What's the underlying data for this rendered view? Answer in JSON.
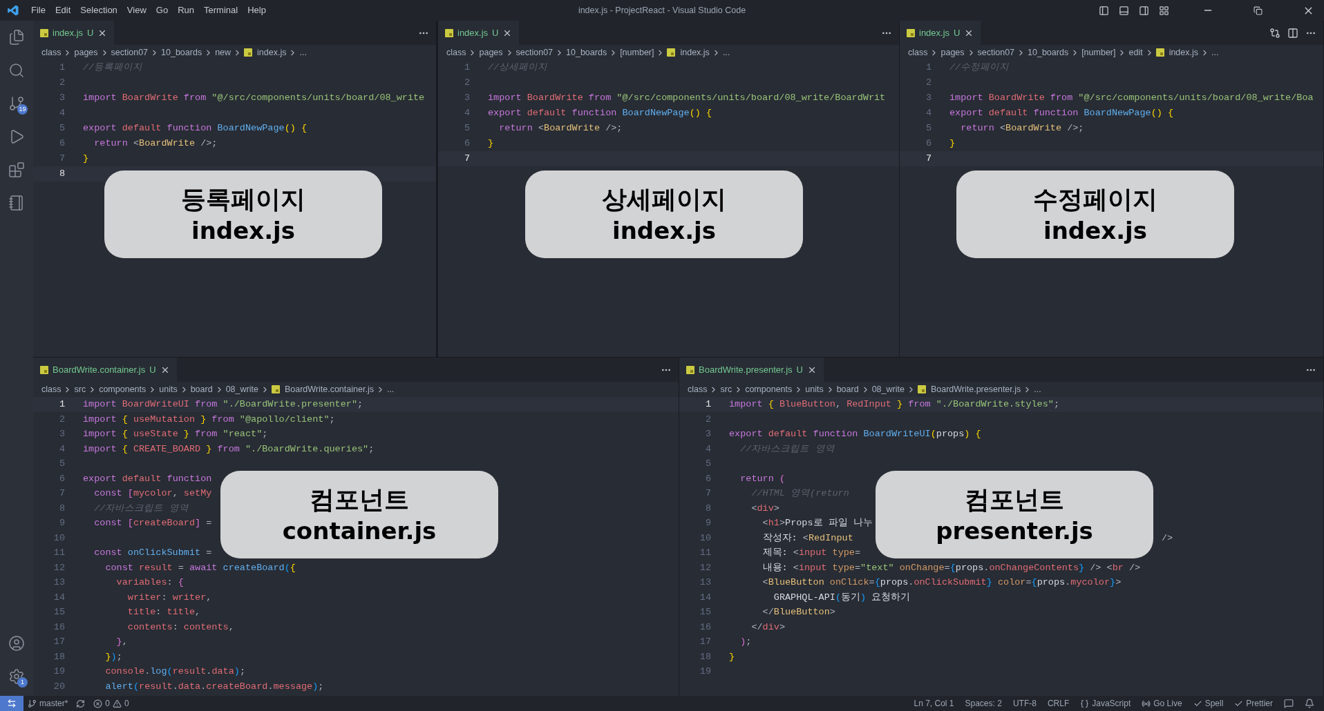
{
  "window": {
    "title": "index.js - ProjectReact - Visual Studio Code"
  },
  "menu": [
    "File",
    "Edit",
    "Selection",
    "View",
    "Go",
    "Run",
    "Terminal",
    "Help"
  ],
  "activity_bar": {
    "top": [
      {
        "kind": "explorer"
      },
      {
        "kind": "search"
      },
      {
        "kind": "source-control",
        "badge": "19"
      },
      {
        "kind": "run"
      },
      {
        "kind": "extensions"
      },
      {
        "kind": "notebook"
      }
    ],
    "bottom": [
      {
        "kind": "account"
      },
      {
        "kind": "settings",
        "badge": "1"
      }
    ]
  },
  "panes": [
    {
      "tab": {
        "label": "index.js",
        "status": "U",
        "selected": true
      },
      "actions": [
        {
          "kind": "more"
        }
      ],
      "breadcrumb": [
        {
          "label": "class",
          "kind": "folder"
        },
        {
          "label": "pages",
          "kind": "folder"
        },
        {
          "label": "section07",
          "kind": "folder"
        },
        {
          "label": "10_boards",
          "kind": "folder"
        },
        {
          "label": "new",
          "kind": "folder"
        },
        {
          "label": "index.js",
          "kind": "file"
        },
        {
          "label": "...",
          "kind": "folder"
        }
      ],
      "lines": [
        {
          "n": "1",
          "active": false,
          "tokens": [
            {
              "kind": "cm",
              "text": "//등록페이지"
            }
          ]
        },
        {
          "n": "2",
          "active": false
        },
        {
          "n": "3",
          "active": false,
          "tokens": [
            {
              "kind": "kw",
              "text": "import "
            },
            {
              "kind": "red",
              "text": "BoardWrite "
            },
            {
              "kind": "kw",
              "text": "from "
            },
            {
              "kind": "str",
              "text": "\"@/src/components/units/board/08_write"
            }
          ]
        },
        {
          "n": "4",
          "active": false
        },
        {
          "n": "5",
          "active": false,
          "tokens": [
            {
              "kind": "kw",
              "text": "export "
            },
            {
              "kind": "red",
              "text": "default "
            },
            {
              "kind": "kw",
              "text": "function "
            },
            {
              "kind": "fn",
              "text": "BoardNewPage"
            },
            {
              "kind": "y",
              "text": "() {"
            }
          ]
        },
        {
          "n": "6",
          "active": false,
          "tokens": [
            {
              "kind": "kw",
              "text": "  return "
            },
            {
              "kind": "pl",
              "text": "<"
            },
            {
              "kind": "tag",
              "text": "BoardWrite"
            },
            {
              "kind": "pl",
              "text": " />;"
            }
          ]
        },
        {
          "n": "7",
          "active": false,
          "tokens": [
            {
              "kind": "y",
              "text": "}"
            }
          ]
        },
        {
          "n": "8",
          "active": true
        }
      ],
      "caption": {
        "title": "등록페이지",
        "file": "index.js"
      }
    },
    {
      "tab": {
        "label": "index.js",
        "status": "U",
        "selected": true
      },
      "actions": [
        {
          "kind": "more"
        }
      ],
      "breadcrumb": [
        {
          "label": "class",
          "kind": "folder"
        },
        {
          "label": "pages",
          "kind": "folder"
        },
        {
          "label": "section07",
          "kind": "folder"
        },
        {
          "label": "10_boards",
          "kind": "folder"
        },
        {
          "label": "[number]",
          "kind": "folder"
        },
        {
          "label": "index.js",
          "kind": "file"
        },
        {
          "label": "...",
          "kind": "folder"
        }
      ],
      "lines": [
        {
          "n": "1",
          "active": false,
          "tokens": [
            {
              "kind": "cm",
              "text": "//상세페이지"
            }
          ]
        },
        {
          "n": "2",
          "active": false
        },
        {
          "n": "3",
          "active": false,
          "tokens": [
            {
              "kind": "kw",
              "text": "import "
            },
            {
              "kind": "red",
              "text": "BoardWrite "
            },
            {
              "kind": "kw",
              "text": "from "
            },
            {
              "kind": "str",
              "text": "\"@/src/components/units/board/08_write/BoardWrit"
            }
          ]
        },
        {
          "n": "4",
          "active": false,
          "tokens": [
            {
              "kind": "kw",
              "text": "export "
            },
            {
              "kind": "red",
              "text": "default "
            },
            {
              "kind": "kw",
              "text": "function "
            },
            {
              "kind": "fn",
              "text": "BoardNewPage"
            },
            {
              "kind": "y",
              "text": "() {"
            }
          ]
        },
        {
          "n": "5",
          "active": false,
          "tokens": [
            {
              "kind": "kw",
              "text": "  return "
            },
            {
              "kind": "pl",
              "text": "<"
            },
            {
              "kind": "tag",
              "text": "BoardWrite"
            },
            {
              "kind": "pl",
              "text": " />;"
            }
          ]
        },
        {
          "n": "6",
          "active": false,
          "tokens": [
            {
              "kind": "y",
              "text": "}"
            }
          ]
        },
        {
          "n": "7",
          "active": true
        }
      ],
      "caption": {
        "title": "상세페이지",
        "file": "index.js"
      }
    },
    {
      "tab": {
        "label": "index.js",
        "status": "U",
        "selected": true
      },
      "actions": [
        {
          "kind": "compare"
        },
        {
          "kind": "split"
        },
        {
          "kind": "more"
        }
      ],
      "breadcrumb": [
        {
          "label": "class",
          "kind": "folder"
        },
        {
          "label": "pages",
          "kind": "folder"
        },
        {
          "label": "section07",
          "kind": "folder"
        },
        {
          "label": "10_boards",
          "kind": "folder"
        },
        {
          "label": "[number]",
          "kind": "folder"
        },
        {
          "label": "edit",
          "kind": "folder"
        },
        {
          "label": "index.js",
          "kind": "file"
        },
        {
          "label": "...",
          "kind": "folder"
        }
      ],
      "lines": [
        {
          "n": "1",
          "active": false,
          "tokens": [
            {
              "kind": "cm",
              "text": "//수정페이지"
            }
          ]
        },
        {
          "n": "2",
          "active": false
        },
        {
          "n": "3",
          "active": false,
          "tokens": [
            {
              "kind": "kw",
              "text": "import "
            },
            {
              "kind": "red",
              "text": "BoardWrite "
            },
            {
              "kind": "kw",
              "text": "from "
            },
            {
              "kind": "str",
              "text": "\"@/src/components/units/board/08_write/Boa"
            }
          ]
        },
        {
          "n": "4",
          "active": false,
          "tokens": [
            {
              "kind": "kw",
              "text": "export "
            },
            {
              "kind": "red",
              "text": "default "
            },
            {
              "kind": "kw",
              "text": "function "
            },
            {
              "kind": "fn",
              "text": "BoardNewPage"
            },
            {
              "kind": "y",
              "text": "() {"
            }
          ]
        },
        {
          "n": "5",
          "active": false,
          "tokens": [
            {
              "kind": "kw",
              "text": "  return "
            },
            {
              "kind": "pl",
              "text": "<"
            },
            {
              "kind": "tag",
              "text": "BoardWrite"
            },
            {
              "kind": "pl",
              "text": " />;"
            }
          ]
        },
        {
          "n": "6",
          "active": false,
          "tokens": [
            {
              "kind": "y",
              "text": "}"
            }
          ]
        },
        {
          "n": "7",
          "active": true
        }
      ],
      "caption": {
        "title": "수정페이지",
        "file": "index.js"
      }
    },
    {
      "tab": {
        "label": "BoardWrite.container.js",
        "status": "U",
        "selected": true
      },
      "actions": [
        {
          "kind": "more"
        }
      ],
      "breadcrumb": [
        {
          "label": "class",
          "kind": "folder"
        },
        {
          "label": "src",
          "kind": "folder"
        },
        {
          "label": "components",
          "kind": "folder"
        },
        {
          "label": "units",
          "kind": "folder"
        },
        {
          "label": "board",
          "kind": "folder"
        },
        {
          "label": "08_write",
          "kind": "folder"
        },
        {
          "label": "BoardWrite.container.js",
          "kind": "file"
        },
        {
          "label": "...",
          "kind": "folder"
        }
      ],
      "lines": [
        {
          "n": "1",
          "active": true,
          "tokens": [
            {
              "kind": "kw",
              "text": "import "
            },
            {
              "kind": "red",
              "text": "BoardWriteUI "
            },
            {
              "kind": "kw",
              "text": "from "
            },
            {
              "kind": "str",
              "text": "\"./BoardWrite.presenter\""
            },
            {
              "kind": "pl",
              "text": ";"
            }
          ]
        },
        {
          "n": "2",
          "active": false,
          "tokens": [
            {
              "kind": "kw",
              "text": "import "
            },
            {
              "kind": "y",
              "text": "{ "
            },
            {
              "kind": "red",
              "text": "useMutation "
            },
            {
              "kind": "y",
              "text": "} "
            },
            {
              "kind": "kw",
              "text": "from "
            },
            {
              "kind": "str",
              "text": "\"@apollo/client\""
            },
            {
              "kind": "pl",
              "text": ";"
            }
          ]
        },
        {
          "n": "3",
          "active": false,
          "tokens": [
            {
              "kind": "kw",
              "text": "import "
            },
            {
              "kind": "y",
              "text": "{ "
            },
            {
              "kind": "red",
              "text": "useState "
            },
            {
              "kind": "y",
              "text": "} "
            },
            {
              "kind": "kw",
              "text": "from "
            },
            {
              "kind": "str",
              "text": "\"react\""
            },
            {
              "kind": "pl",
              "text": ";"
            }
          ]
        },
        {
          "n": "4",
          "active": false,
          "tokens": [
            {
              "kind": "kw",
              "text": "import "
            },
            {
              "kind": "y",
              "text": "{ "
            },
            {
              "kind": "red",
              "text": "CREATE_BOARD "
            },
            {
              "kind": "y",
              "text": "} "
            },
            {
              "kind": "kw",
              "text": "from "
            },
            {
              "kind": "str",
              "text": "\"./BoardWrite.queries\""
            },
            {
              "kind": "pl",
              "text": ";"
            }
          ]
        },
        {
          "n": "5",
          "active": false
        },
        {
          "n": "6",
          "active": false,
          "tokens": [
            {
              "kind": "kw",
              "text": "export "
            },
            {
              "kind": "red",
              "text": "default "
            },
            {
              "kind": "kw",
              "text": "function"
            }
          ]
        },
        {
          "n": "7",
          "active": false,
          "tokens": [
            {
              "kind": "kw",
              "text": "  const "
            },
            {
              "kind": "m",
              "text": "["
            },
            {
              "kind": "red",
              "text": "mycolor"
            },
            {
              "kind": "pl",
              "text": ", "
            },
            {
              "kind": "red",
              "text": "setMy"
            }
          ]
        },
        {
          "n": "8",
          "active": false,
          "tokens": [
            {
              "kind": "cm",
              "text": "  //자바스크립트 영역"
            }
          ]
        },
        {
          "n": "9",
          "active": false,
          "tokens": [
            {
              "kind": "kw",
              "text": "  const "
            },
            {
              "kind": "m",
              "text": "["
            },
            {
              "kind": "red",
              "text": "createBoard"
            },
            {
              "kind": "m",
              "text": "]"
            },
            {
              "kind": "pl",
              "text": " ="
            }
          ]
        },
        {
          "n": "10",
          "active": false
        },
        {
          "n": "11",
          "active": false,
          "tokens": [
            {
              "kind": "kw",
              "text": "  const "
            },
            {
              "kind": "fn",
              "text": "onClickSubmit"
            },
            {
              "kind": "pl",
              "text": " ="
            }
          ]
        },
        {
          "n": "12",
          "active": false,
          "tokens": [
            {
              "kind": "kw",
              "text": "    const "
            },
            {
              "kind": "red",
              "text": "result"
            },
            {
              "kind": "pl",
              "text": " = "
            },
            {
              "kind": "kw",
              "text": "await "
            },
            {
              "kind": "fn",
              "text": "createBoard"
            },
            {
              "kind": "bl",
              "text": "("
            },
            {
              "kind": "y",
              "text": "{"
            }
          ]
        },
        {
          "n": "13",
          "active": false,
          "tokens": [
            {
              "kind": "red",
              "text": "      variables"
            },
            {
              "kind": "pl",
              "text": ": "
            },
            {
              "kind": "m",
              "text": "{"
            }
          ]
        },
        {
          "n": "14",
          "active": false,
          "tokens": [
            {
              "kind": "red",
              "text": "        writer"
            },
            {
              "kind": "pl",
              "text": ": "
            },
            {
              "kind": "red",
              "text": "writer"
            },
            {
              "kind": "pl",
              "text": ","
            }
          ]
        },
        {
          "n": "15",
          "active": false,
          "tokens": [
            {
              "kind": "red",
              "text": "        title"
            },
            {
              "kind": "pl",
              "text": ": "
            },
            {
              "kind": "red",
              "text": "title"
            },
            {
              "kind": "pl",
              "text": ","
            }
          ]
        },
        {
          "n": "16",
          "active": false,
          "tokens": [
            {
              "kind": "red",
              "text": "        contents"
            },
            {
              "kind": "pl",
              "text": ": "
            },
            {
              "kind": "red",
              "text": "contents"
            },
            {
              "kind": "pl",
              "text": ","
            }
          ]
        },
        {
          "n": "17",
          "active": false,
          "tokens": [
            {
              "kind": "m",
              "text": "      }"
            },
            {
              "kind": "pl",
              "text": ","
            }
          ]
        },
        {
          "n": "18",
          "active": false,
          "tokens": [
            {
              "kind": "y",
              "text": "    }"
            },
            {
              "kind": "bl",
              "text": ")"
            },
            {
              "kind": "pl",
              "text": ";"
            }
          ]
        },
        {
          "n": "19",
          "active": false,
          "tokens": [
            {
              "kind": "red",
              "text": "    console"
            },
            {
              "kind": "pl",
              "text": "."
            },
            {
              "kind": "fn",
              "text": "log"
            },
            {
              "kind": "bl",
              "text": "("
            },
            {
              "kind": "red",
              "text": "result"
            },
            {
              "kind": "pl",
              "text": "."
            },
            {
              "kind": "red",
              "text": "data"
            },
            {
              "kind": "bl",
              "text": ")"
            },
            {
              "kind": "pl",
              "text": ";"
            }
          ]
        },
        {
          "n": "20",
          "active": false,
          "tokens": [
            {
              "kind": "fn",
              "text": "    alert"
            },
            {
              "kind": "bl",
              "text": "("
            },
            {
              "kind": "red",
              "text": "result"
            },
            {
              "kind": "pl",
              "text": "."
            },
            {
              "kind": "red",
              "text": "data"
            },
            {
              "kind": "pl",
              "text": "."
            },
            {
              "kind": "red",
              "text": "createBoard"
            },
            {
              "kind": "pl",
              "text": "."
            },
            {
              "kind": "red",
              "text": "message"
            },
            {
              "kind": "bl",
              "text": ")"
            },
            {
              "kind": "pl",
              "text": ";"
            }
          ]
        }
      ],
      "caption": {
        "title": "컴포넌트",
        "file": "container.js"
      }
    },
    {
      "tab": {
        "label": "BoardWrite.presenter.js",
        "status": "U",
        "selected": true
      },
      "actions": [
        {
          "kind": "more"
        }
      ],
      "breadcrumb": [
        {
          "label": "class",
          "kind": "folder"
        },
        {
          "label": "src",
          "kind": "folder"
        },
        {
          "label": "components",
          "kind": "folder"
        },
        {
          "label": "units",
          "kind": "folder"
        },
        {
          "label": "board",
          "kind": "folder"
        },
        {
          "label": "08_write",
          "kind": "folder"
        },
        {
          "label": "BoardWrite.presenter.js",
          "kind": "file"
        },
        {
          "label": "...",
          "kind": "folder"
        }
      ],
      "lines": [
        {
          "n": "1",
          "active": true,
          "tokens": [
            {
              "kind": "kw",
              "text": "import "
            },
            {
              "kind": "y",
              "text": "{ "
            },
            {
              "kind": "red",
              "text": "BlueButton"
            },
            {
              "kind": "pl",
              "text": ", "
            },
            {
              "kind": "red",
              "text": "RedInput "
            },
            {
              "kind": "y",
              "text": "} "
            },
            {
              "kind": "kw",
              "text": "from "
            },
            {
              "kind": "str",
              "text": "\"./BoardWrite.styles\""
            },
            {
              "kind": "pl",
              "text": ";"
            }
          ]
        },
        {
          "n": "2",
          "active": false
        },
        {
          "n": "3",
          "active": false,
          "tokens": [
            {
              "kind": "kw",
              "text": "export "
            },
            {
              "kind": "red",
              "text": "default "
            },
            {
              "kind": "kw",
              "text": "function "
            },
            {
              "kind": "fn",
              "text": "BoardWriteUI"
            },
            {
              "kind": "y",
              "text": "("
            },
            {
              "kind": "w",
              "text": "props"
            },
            {
              "kind": "y",
              "text": ") {"
            }
          ]
        },
        {
          "n": "4",
          "active": false,
          "tokens": [
            {
              "kind": "cm",
              "text": "  //자바스크립트 영역"
            }
          ]
        },
        {
          "n": "5",
          "active": false
        },
        {
          "n": "6",
          "active": false,
          "tokens": [
            {
              "kind": "kw",
              "text": "  return "
            },
            {
              "kind": "m",
              "text": "("
            }
          ]
        },
        {
          "n": "7",
          "active": false,
          "tokens": [
            {
              "kind": "cm",
              "text": "    //HTML 영역(return"
            }
          ]
        },
        {
          "n": "8",
          "active": false,
          "tokens": [
            {
              "kind": "pl",
              "text": "    <"
            },
            {
              "kind": "red",
              "text": "div"
            },
            {
              "kind": "pl",
              "text": ">"
            }
          ]
        },
        {
          "n": "9",
          "active": false,
          "tokens": [
            {
              "kind": "pl",
              "text": "      <"
            },
            {
              "kind": "red",
              "text": "h1"
            },
            {
              "kind": "pl",
              "text": ">"
            },
            {
              "kind": "w",
              "text": "Props로 파일 나누"
            }
          ]
        },
        {
          "n": "10",
          "active": false,
          "tokens": [
            {
              "kind": "w",
              "text": "      작성자: "
            },
            {
              "kind": "pl",
              "text": "<"
            },
            {
              "kind": "tag",
              "text": "RedInput"
            }
          ],
          "after": [
            {
              "kind": "pl",
              "text": "/>"
            }
          ]
        },
        {
          "n": "11",
          "active": false,
          "tokens": [
            {
              "kind": "w",
              "text": "      제목: "
            },
            {
              "kind": "pl",
              "text": "<"
            },
            {
              "kind": "red",
              "text": "input "
            },
            {
              "kind": "attr",
              "text": "type"
            },
            {
              "kind": "pl",
              "text": "="
            }
          ]
        },
        {
          "n": "12",
          "active": false,
          "tokens": [
            {
              "kind": "w",
              "text": "      내용: "
            },
            {
              "kind": "pl",
              "text": "<"
            },
            {
              "kind": "red",
              "text": "input "
            },
            {
              "kind": "attr",
              "text": "type"
            },
            {
              "kind": "pl",
              "text": "="
            },
            {
              "kind": "str",
              "text": "\"text\" "
            },
            {
              "kind": "attr",
              "text": "onChange"
            },
            {
              "kind": "pl",
              "text": "="
            },
            {
              "kind": "bl",
              "text": "{"
            },
            {
              "kind": "w",
              "text": "props"
            },
            {
              "kind": "pl",
              "text": "."
            },
            {
              "kind": "red",
              "text": "onChangeContents"
            },
            {
              "kind": "bl",
              "text": "}"
            },
            {
              "kind": "pl",
              "text": " /> <"
            },
            {
              "kind": "red",
              "text": "br"
            },
            {
              "kind": "pl",
              "text": " />"
            }
          ]
        },
        {
          "n": "13",
          "active": false,
          "tokens": [
            {
              "kind": "pl",
              "text": "      <"
            },
            {
              "kind": "tag",
              "text": "BlueButton "
            },
            {
              "kind": "attr",
              "text": "onClick"
            },
            {
              "kind": "pl",
              "text": "="
            },
            {
              "kind": "bl",
              "text": "{"
            },
            {
              "kind": "w",
              "text": "props"
            },
            {
              "kind": "pl",
              "text": "."
            },
            {
              "kind": "red",
              "text": "onClickSubmit"
            },
            {
              "kind": "bl",
              "text": "} "
            },
            {
              "kind": "attr",
              "text": "color"
            },
            {
              "kind": "pl",
              "text": "="
            },
            {
              "kind": "bl",
              "text": "{"
            },
            {
              "kind": "w",
              "text": "props"
            },
            {
              "kind": "pl",
              "text": "."
            },
            {
              "kind": "red",
              "text": "mycolor"
            },
            {
              "kind": "bl",
              "text": "}"
            },
            {
              "kind": "pl",
              "text": ">"
            }
          ]
        },
        {
          "n": "14",
          "active": false,
          "tokens": [
            {
              "kind": "w",
              "text": "        GRAPHQL-API"
            },
            {
              "kind": "bl",
              "text": "("
            },
            {
              "kind": "w",
              "text": "동기"
            },
            {
              "kind": "bl",
              "text": ")"
            },
            {
              "kind": "w",
              "text": " 요청하기"
            }
          ]
        },
        {
          "n": "15",
          "active": false,
          "tokens": [
            {
              "kind": "pl",
              "text": "      </"
            },
            {
              "kind": "tag",
              "text": "BlueButton"
            },
            {
              "kind": "pl",
              "text": ">"
            }
          ]
        },
        {
          "n": "16",
          "active": false,
          "tokens": [
            {
              "kind": "pl",
              "text": "    </"
            },
            {
              "kind": "red",
              "text": "div"
            },
            {
              "kind": "pl",
              "text": ">"
            }
          ]
        },
        {
          "n": "17",
          "active": false,
          "tokens": [
            {
              "kind": "m",
              "text": "  )"
            },
            {
              "kind": "pl",
              "text": ";"
            }
          ]
        },
        {
          "n": "18",
          "active": false,
          "tokens": [
            {
              "kind": "y",
              "text": "}"
            }
          ]
        },
        {
          "n": "19",
          "active": false
        }
      ],
      "caption": {
        "title": "컴포넌트",
        "file": "presenter.js"
      }
    }
  ],
  "status_bar": {
    "left": [
      {
        "kind": "remote"
      },
      {
        "kind": "branch",
        "text": "master*"
      },
      {
        "kind": "sync"
      },
      {
        "kind": "problems",
        "errors": "0",
        "warnings": "0"
      }
    ],
    "right": [
      {
        "kind": "text",
        "text": "Ln 7, Col 1"
      },
      {
        "kind": "text",
        "text": "Spaces: 2"
      },
      {
        "kind": "text",
        "text": "UTF-8"
      },
      {
        "kind": "text",
        "text": "CRLF"
      },
      {
        "kind": "language",
        "text": "JavaScript"
      },
      {
        "kind": "golive",
        "text": "Go Live"
      },
      {
        "kind": "check",
        "text": "Spell"
      },
      {
        "kind": "check",
        "text": "Prettier"
      },
      {
        "kind": "feedback"
      },
      {
        "kind": "bell"
      }
    ]
  }
}
